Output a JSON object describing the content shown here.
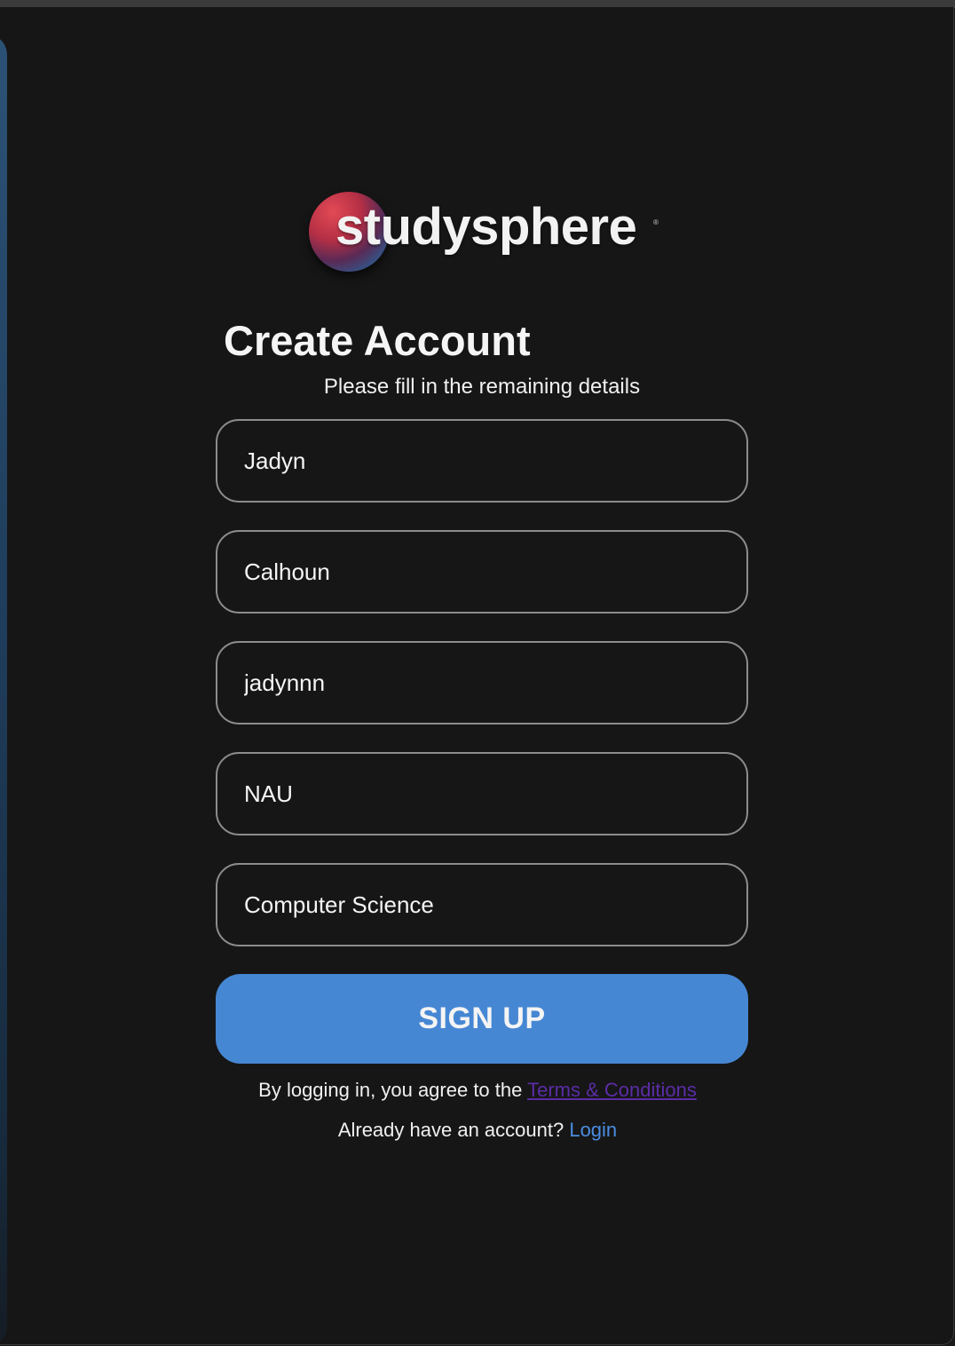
{
  "brand": {
    "name": "studysphere",
    "registered_mark": "®"
  },
  "form": {
    "title": "Create Account",
    "subtitle": "Please fill in the remaining details",
    "fields": [
      {
        "name": "first-name",
        "value": "Jadyn"
      },
      {
        "name": "last-name",
        "value": "Calhoun"
      },
      {
        "name": "username",
        "value": "jadynnn"
      },
      {
        "name": "school",
        "value": "NAU"
      },
      {
        "name": "major",
        "value": "Computer Science"
      }
    ],
    "submit_label": "SIGN UP"
  },
  "footer": {
    "terms_prefix": "By logging in, you agree to the ",
    "terms_link": "Terms & Conditions",
    "login_prefix": "Already have an account? ",
    "login_link": "Login"
  },
  "colors": {
    "background": "#161616",
    "button": "#4687d3",
    "terms_link": "#5b2ca6",
    "login_link": "#4a8de0",
    "field_border": "#8c8c8c"
  }
}
